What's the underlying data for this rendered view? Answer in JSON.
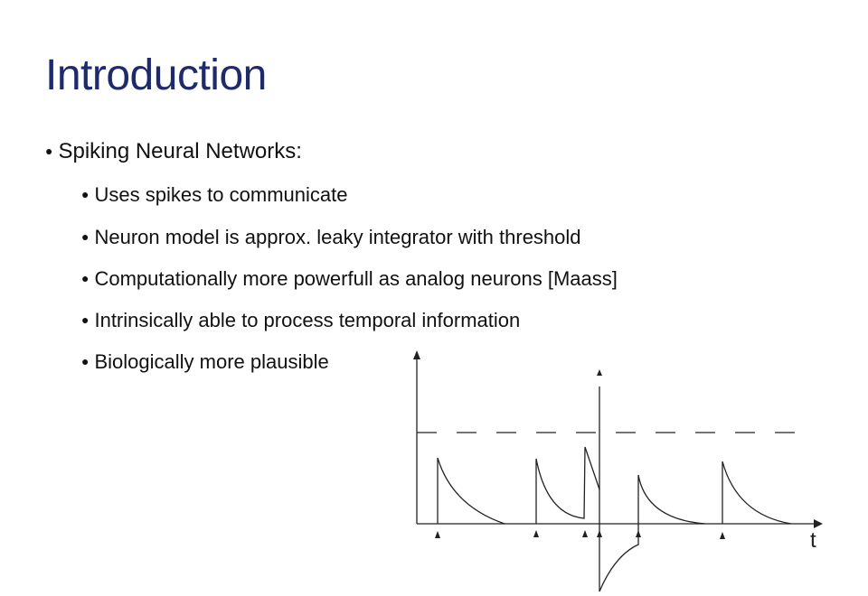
{
  "slide": {
    "title": "Introduction",
    "bullet": "Spiking Neural Networks:",
    "subbullets": [
      "Uses spikes to communicate",
      "Neuron model is approx. leaky integrator with threshold",
      "Computationally more powerfull as analog neurons [Maass]",
      "Intrinsically able to process temporal information",
      "Biologically more plausible"
    ],
    "figure": {
      "axis_label": "t"
    }
  }
}
